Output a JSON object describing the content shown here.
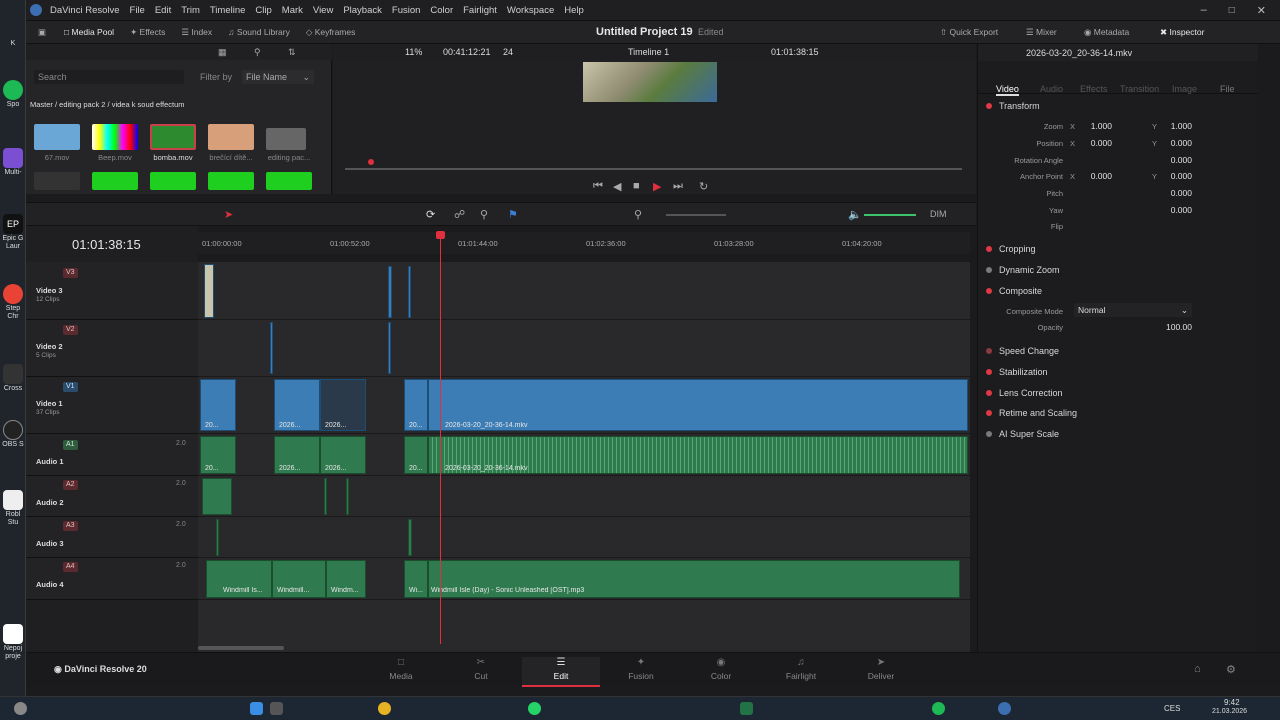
{
  "app": {
    "name": "DaVinci Resolve",
    "menu": [
      "File",
      "Edit",
      "Trim",
      "Timeline",
      "Clip",
      "Mark",
      "View",
      "Playback",
      "Fusion",
      "Color",
      "Fairlight",
      "Workspace",
      "Help"
    ]
  },
  "desktop": {
    "icons": [
      "K",
      "Spo",
      "Multi-",
      "Epic G\nLaur",
      "Step\nChr",
      "Cross",
      "OBS S",
      "Robl\nStu",
      "Nepoj\nproje"
    ]
  },
  "toolbar": {
    "media_pool": "Media Pool",
    "effects": "Effects",
    "index": "Index",
    "sound_library": "Sound Library",
    "keyframes": "Keyframes",
    "project_title": "Untitled Project 19",
    "project_status": "Edited",
    "quick_export": "Quick Export",
    "mixer": "Mixer",
    "metadata": "Metadata",
    "inspector": "Inspector"
  },
  "viewerbar": {
    "zoom": "11%",
    "duration": "00:41:12:21",
    "clips": "24",
    "timeline": "Timeline 1",
    "timecode": "01:01:38:15",
    "clipname": "2026-03-20_20-36-14.mkv"
  },
  "pool": {
    "search_placeholder": "Search",
    "filter_by": "Filter by",
    "filter_value": "File Name",
    "breadcrumb": "Master / editing pack 2 / videa k soud effectum",
    "items": [
      {
        "label": "67.mov",
        "color": "#6aa6d6"
      },
      {
        "label": "Beep.mov",
        "color": "#c9c9c9"
      },
      {
        "label": "bomba.mov",
        "color": "#2e8a2e"
      },
      {
        "label": "brečící dítě...",
        "color": "#d8a07a"
      },
      {
        "label": "editing pac...",
        "color": "#666666"
      }
    ]
  },
  "inspector": {
    "tabs": [
      "Video",
      "Audio",
      "Effects",
      "Transition",
      "Image",
      "File"
    ],
    "transform": "Transform",
    "zoom_label": "Zoom",
    "zoom_x": "1.000",
    "zoom_y": "1.000",
    "position_label": "Position",
    "pos_x": "0.000",
    "pos_y": "0.000",
    "rotation_label": "Rotation Angle",
    "rotation": "0.000",
    "anchor_label": "Anchor Point",
    "anchor_x": "0.000",
    "anchor_y": "0.000",
    "pitch_label": "Pitch",
    "pitch": "0.000",
    "yaw_label": "Yaw",
    "yaw": "0.000",
    "flip_label": "Flip",
    "x": "X",
    "y": "Y",
    "sections": [
      "Cropping",
      "Dynamic Zoom",
      "Composite",
      "Speed Change",
      "Stabilization",
      "Lens Correction",
      "Retime and Scaling",
      "AI Super Scale"
    ],
    "composite_mode_label": "Composite Mode",
    "composite_mode": "Normal",
    "opacity_label": "Opacity",
    "opacity": "100.00"
  },
  "timeline": {
    "timecode": "01:01:38:15",
    "ruler": [
      "01:00:00:00",
      "01:00:52:00",
      "01:01:44:00",
      "01:02:36:00",
      "01:03:28:00",
      "01:04:20:00"
    ],
    "tracks": [
      {
        "id": "V3",
        "name": "Video 3",
        "sub": "12 Clips"
      },
      {
        "id": "V2",
        "name": "Video 2",
        "sub": "5 Clips"
      },
      {
        "id": "V1",
        "name": "Video 1",
        "sub": "37 Clips"
      },
      {
        "id": "A1",
        "name": "Audio 1",
        "vol": "2.0"
      },
      {
        "id": "A2",
        "name": "Audio 2",
        "vol": "2.0"
      },
      {
        "id": "A3",
        "name": "Audio 3",
        "vol": "2.0"
      },
      {
        "id": "A4",
        "name": "Audio 4",
        "vol": "2.0"
      }
    ],
    "v1_clip_labels": [
      "20...",
      "2026...",
      "2026...",
      "20...",
      "2026-03-20_20-36-14.mkv"
    ],
    "a1_clip_labels": [
      "20...",
      "2026...",
      "2026...",
      "20...",
      "2026-03-20_20-36-14.mkv"
    ],
    "a4_clip_labels": [
      "Windmill Is...",
      "Windmill...",
      "Windm...",
      "Wi...",
      "Windmill Isle (Day) - Sonic Unleashed [OST].mp3"
    ],
    "dim": "DIM"
  },
  "pages": [
    "Media",
    "Cut",
    "Edit",
    "Fusion",
    "Color",
    "Fairlight",
    "Deliver"
  ],
  "brand": "DaVinci Resolve 20",
  "taskbar": {
    "lang": "CES",
    "time": "9:42",
    "date": "21.03.2026"
  }
}
